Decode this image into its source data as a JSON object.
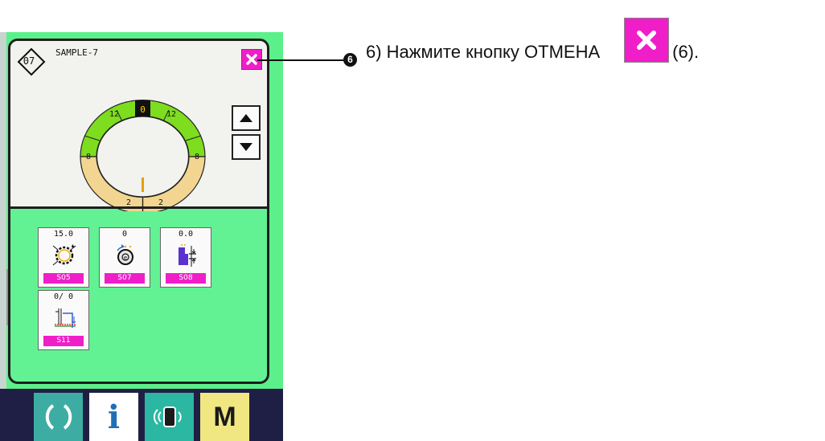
{
  "screen": {
    "pattern_no": "07",
    "pattern_name": "SAMPLE-7"
  },
  "ring": {
    "top_label": "0",
    "labels": [
      "12",
      "12",
      "8",
      "8",
      "2",
      "2"
    ]
  },
  "settings": [
    {
      "value": "15.0",
      "code": "S05",
      "icon": "stitch-circle-icon"
    },
    {
      "value": "0",
      "code": "S07",
      "icon": "bobbin-rotation-icon"
    },
    {
      "value": "0.0",
      "code": "S08",
      "icon": "presser-height-icon"
    },
    {
      "value": "0/  0",
      "code": "S11",
      "icon": "thread-tension-icon"
    }
  ],
  "nav": {
    "info_label": "i",
    "mode_label": "M"
  },
  "callout": {
    "marker": "6"
  },
  "instruction": {
    "prefix": "6) Нажмите кнопку ОТМЕНА",
    "suffix": "(6)."
  },
  "colors": {
    "panel_green": "#5cf08a",
    "cancel_magenta": "#f01ec8",
    "ring_green": "#7ddd1e",
    "ring_tan": "#f2d590",
    "nav_dark": "#1f1f46"
  }
}
